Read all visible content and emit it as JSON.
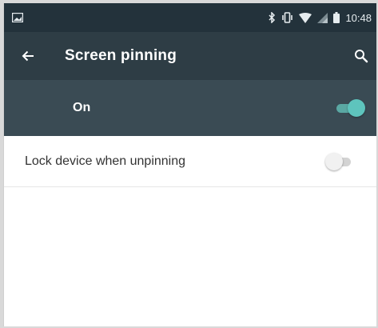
{
  "colors": {
    "statusbar_bg": "#23323b",
    "toolbar_bg": "#2e3d45",
    "master_switch_bg": "#3a4b54",
    "accent": "#5ec4bd"
  },
  "statusbar": {
    "notification_icon": "image-notification-icon",
    "icons": [
      "bluetooth-icon",
      "vibrate-icon",
      "wifi-icon",
      "signal-icon",
      "battery-icon"
    ],
    "time": "10:48"
  },
  "toolbar": {
    "back_icon": "arrow-left-icon",
    "title": "Screen pinning",
    "search_icon": "search-icon"
  },
  "master_switch": {
    "label": "On",
    "state": "on"
  },
  "preferences": [
    {
      "label": "Lock device when unpinning",
      "state": "off"
    }
  ]
}
